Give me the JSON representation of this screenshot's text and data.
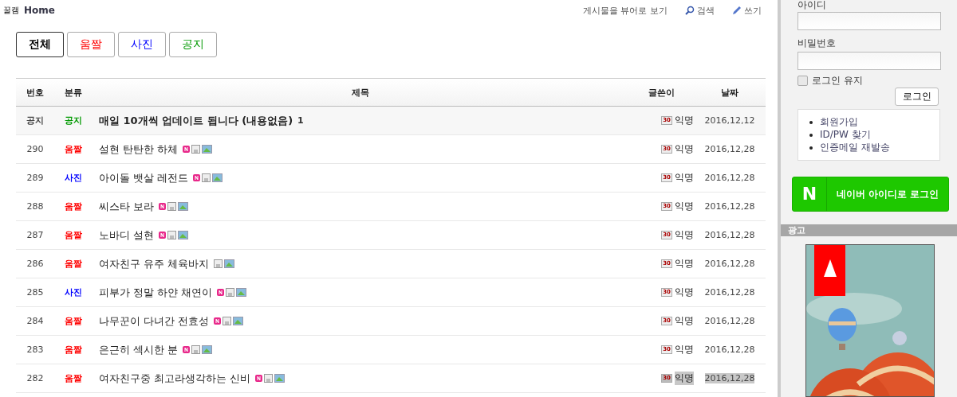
{
  "header": {
    "site": "꿀캠",
    "title": "Home",
    "links": [
      {
        "kind": "plain",
        "label": "게시물을 뷰어로 보기"
      },
      {
        "kind": "search",
        "label": "검색"
      },
      {
        "kind": "write",
        "label": "쓰기"
      }
    ]
  },
  "filters": [
    {
      "label": "전체",
      "selected": true,
      "color": "#000000"
    },
    {
      "label": "움짤",
      "selected": false,
      "color": "#ff0000"
    },
    {
      "label": "사진",
      "selected": false,
      "color": "#0000ff"
    },
    {
      "label": "공지",
      "selected": false,
      "color": "#009900"
    }
  ],
  "table": {
    "columns": [
      "번호",
      "분류",
      "제목",
      "글쓴이",
      "날짜"
    ],
    "rows": [
      {
        "kind": "notice",
        "number": "공지",
        "category": "공지",
        "color": "#009900",
        "title": "매일 10개씩 업데이트 됩니다 (내용없음)",
        "comments": "1",
        "badge": "30",
        "writer": "익명",
        "date": "2016,12,12",
        "highlighted": false
      },
      {
        "kind": "post",
        "number": "290",
        "category": "움짤",
        "color": "#ff0000",
        "title": "설현 탄탄한 하체",
        "new": true,
        "badge": "30",
        "writer": "익명",
        "date": "2016,12,28",
        "highlighted": false
      },
      {
        "kind": "post",
        "number": "289",
        "category": "사진",
        "color": "#0000ff",
        "title": "아이돌 뱃살 레전드",
        "new": true,
        "badge": "30",
        "writer": "익명",
        "date": "2016,12,28",
        "highlighted": false
      },
      {
        "kind": "post",
        "number": "288",
        "category": "움짤",
        "color": "#ff0000",
        "title": "씨스타 보라",
        "new": true,
        "badge": "30",
        "writer": "익명",
        "date": "2016,12,28",
        "highlighted": false
      },
      {
        "kind": "post",
        "number": "287",
        "category": "움짤",
        "color": "#ff0000",
        "title": "노바디 설현",
        "new": true,
        "badge": "30",
        "writer": "익명",
        "date": "2016,12,28",
        "highlighted": false
      },
      {
        "kind": "post",
        "number": "286",
        "category": "움짤",
        "color": "#ff0000",
        "title": "여자친구 유주 체육바지",
        "new": false,
        "badge": "30",
        "writer": "익명",
        "date": "2016,12,28",
        "highlighted": false
      },
      {
        "kind": "post",
        "number": "285",
        "category": "사진",
        "color": "#0000ff",
        "title": "피부가 정말 하얀 채연이",
        "new": true,
        "badge": "30",
        "writer": "익명",
        "date": "2016,12,28",
        "highlighted": false
      },
      {
        "kind": "post",
        "number": "284",
        "category": "움짤",
        "color": "#ff0000",
        "title": "나무꾼이 다녀간 전효성",
        "new": true,
        "badge": "30",
        "writer": "익명",
        "date": "2016,12,28",
        "highlighted": false
      },
      {
        "kind": "post",
        "number": "283",
        "category": "움짤",
        "color": "#ff0000",
        "title": "은근히 섹시한 분",
        "new": true,
        "badge": "30",
        "writer": "익명",
        "date": "2016,12,28",
        "highlighted": false
      },
      {
        "kind": "post",
        "number": "282",
        "category": "움짤",
        "color": "#ff0000",
        "title": "여자친구중 최고라생각하는 신비",
        "new": true,
        "badge": "30",
        "writer": "익명",
        "date": "2016,12,28",
        "highlighted": true
      }
    ]
  },
  "login": {
    "id_label": "아이디",
    "password_label": "비밀번호",
    "remember": {
      "label": "로그인 유지",
      "checked": false
    },
    "button": "로그인",
    "links": [
      "회원가입",
      "ID/PW 찾기",
      "인증메일 재발송"
    ],
    "naver": {
      "logo": "N",
      "label": "네이버 아이디로 로그인"
    }
  },
  "ad": {
    "title": "광고"
  }
}
